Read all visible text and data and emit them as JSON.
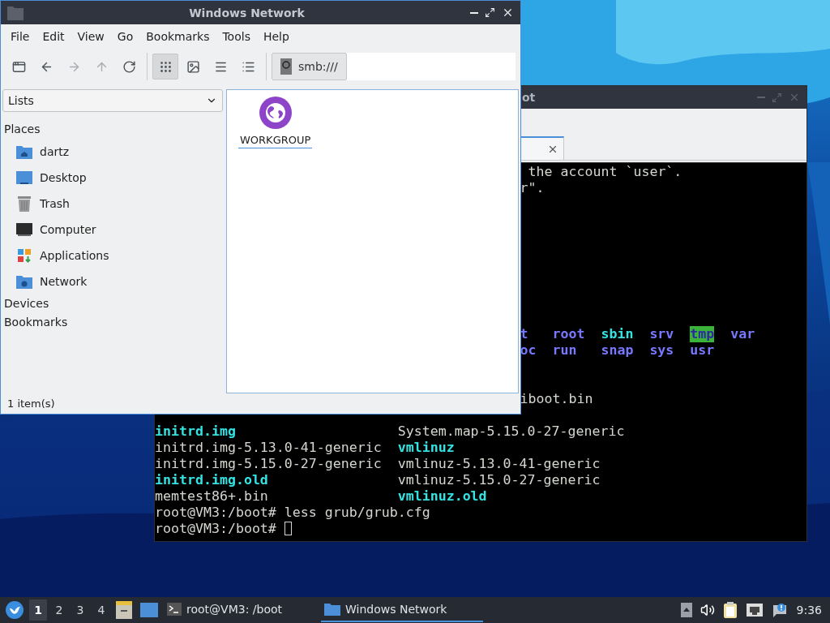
{
  "file_manager": {
    "title": "Windows Network",
    "menu": [
      {
        "label": "File"
      },
      {
        "label": "Edit"
      },
      {
        "label": "View"
      },
      {
        "label": "Go"
      },
      {
        "label": "Bookmarks"
      },
      {
        "label": "Tools"
      },
      {
        "label": "Help"
      }
    ],
    "toolbar": [
      {
        "kind": "new_window",
        "disabled": false
      },
      {
        "kind": "back",
        "disabled": false
      },
      {
        "kind": "forward",
        "disabled": true
      },
      {
        "kind": "up",
        "disabled": true
      },
      {
        "kind": "reload",
        "disabled": false
      }
    ],
    "views": [
      {
        "kind": "icons",
        "selected": true
      },
      {
        "kind": "thumbnails",
        "selected": false
      },
      {
        "kind": "compact",
        "selected": false
      },
      {
        "kind": "details",
        "selected": false
      }
    ],
    "location": "smb:///",
    "side_pane_mode": "Lists",
    "sections": [
      {
        "title": "Places",
        "items": [
          {
            "label": "dartz",
            "kind": "home"
          },
          {
            "label": "Desktop",
            "kind": "desktop"
          },
          {
            "label": "Trash",
            "kind": "trash"
          },
          {
            "label": "Computer",
            "kind": "computer"
          },
          {
            "label": "Applications",
            "kind": "apps"
          },
          {
            "label": "Network",
            "kind": "network"
          }
        ]
      },
      {
        "title": "Devices"
      },
      {
        "title": "Bookmarks"
      }
    ],
    "items": [
      {
        "label": "WORKGROUP",
        "kind": "network",
        "selected": false
      }
    ],
    "status": "1 item(s)"
  },
  "terminal": {
    "title": "ot",
    "lines": [
      {
        "kind": "clipped",
        "text": " the account `user`."
      },
      {
        "kind": "clipped",
        "text": "r\"."
      },
      {
        "kind": "blank"
      },
      {
        "kind": "blank"
      },
      {
        "kind": "blank"
      },
      {
        "kind": "blank"
      },
      {
        "kind": "blank"
      },
      {
        "kind": "blank"
      },
      {
        "kind": "blank"
      },
      {
        "kind": "blank"
      },
      {
        "kind": "ls",
        "cells": [
          {
            "text": "t",
            "kind": "dir"
          },
          {
            "text": "root",
            "kind": "dir"
          },
          {
            "text": "sbin",
            "kind": "link"
          },
          {
            "text": "srv",
            "kind": "dir"
          },
          {
            "text": "tmp",
            "kind": "sticky"
          },
          {
            "text": "var",
            "kind": "dir"
          }
        ]
      },
      {
        "kind": "ls",
        "cells": [
          {
            "text": "oc",
            "kind": "dir"
          },
          {
            "text": "run",
            "kind": "dir"
          },
          {
            "text": "snap",
            "kind": "dir"
          },
          {
            "text": "sys",
            "kind": "dir"
          },
          {
            "text": "usr",
            "kind": "dir"
          }
        ]
      },
      {
        "kind": "blank"
      },
      {
        "kind": "blank"
      },
      {
        "kind": "clipped",
        "text": "iboot.bin"
      },
      {
        "kind": "blank"
      },
      {
        "kind": "columns",
        "cells": [
          {
            "text": "initrd.img",
            "kind": "link"
          },
          {
            "text": "System.map-5.15.0-27-generic",
            "kind": "file"
          }
        ]
      },
      {
        "kind": "columns",
        "cells": [
          {
            "text": "initrd.img-5.13.0-41-generic",
            "kind": "file"
          },
          {
            "text": "vmlinuz",
            "kind": "link"
          }
        ]
      },
      {
        "kind": "columns",
        "cells": [
          {
            "text": "initrd.img-5.15.0-27-generic",
            "kind": "file"
          },
          {
            "text": "vmlinuz-5.13.0-41-generic",
            "kind": "file"
          }
        ]
      },
      {
        "kind": "columns",
        "cells": [
          {
            "text": "initrd.img.old",
            "kind": "link"
          },
          {
            "text": "vmlinuz-5.15.0-27-generic",
            "kind": "file"
          }
        ]
      },
      {
        "kind": "columns",
        "cells": [
          {
            "text": "memtest86+.bin",
            "kind": "file"
          },
          {
            "text": "vmlinuz.old",
            "kind": "link"
          }
        ]
      },
      {
        "kind": "prompt",
        "text": "root@VM3:/boot# less grub/grub.cfg",
        "cursor": false
      },
      {
        "kind": "prompt",
        "text": "root@VM3:/boot#",
        "cursor": true
      }
    ]
  },
  "taskbar": {
    "workspaces": [
      {
        "label": "1",
        "selected": true
      },
      {
        "label": "2",
        "selected": false
      },
      {
        "label": "3",
        "selected": false
      },
      {
        "label": "4",
        "selected": false
      }
    ],
    "launchers": [
      {
        "kind": "files"
      },
      {
        "kind": "desktop"
      }
    ],
    "tasks": [
      {
        "label": "root@VM3: /boot",
        "kind": "terminal",
        "selected": false
      },
      {
        "label": "Windows Network",
        "kind": "folder",
        "selected": true
      }
    ],
    "tray": [
      {
        "kind": "expand"
      },
      {
        "kind": "volume"
      },
      {
        "kind": "clipboard"
      },
      {
        "kind": "network"
      },
      {
        "kind": "notify"
      }
    ],
    "clock": "9:36"
  }
}
